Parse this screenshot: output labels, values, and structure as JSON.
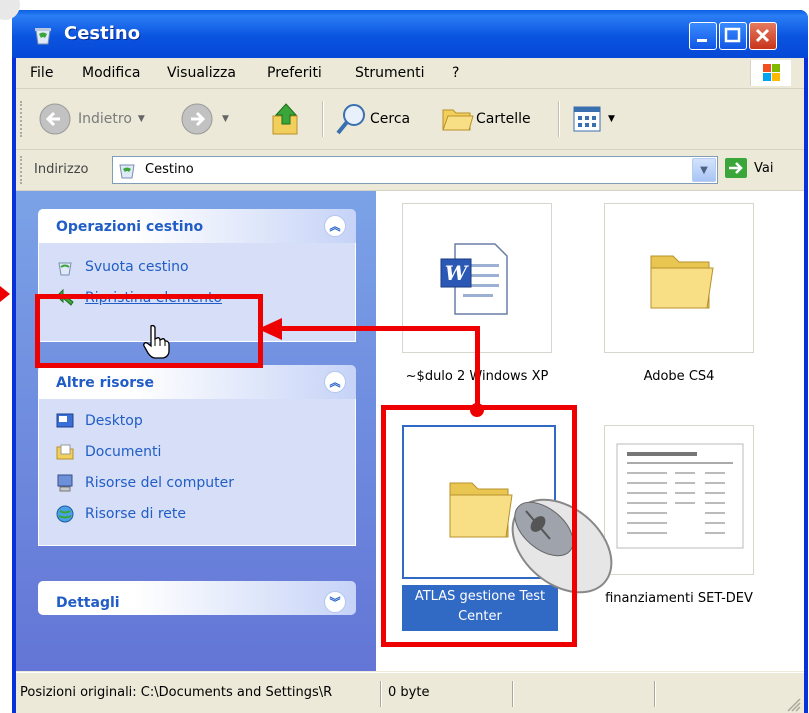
{
  "window": {
    "title": "Cestino"
  },
  "menu": [
    "File",
    "Modifica",
    "Visualizza",
    "Preferiti",
    "Strumenti",
    "?"
  ],
  "toolbar": {
    "back_label": "Indietro",
    "search_label": "Cerca",
    "folders_label": "Cartelle"
  },
  "address": {
    "label": "Indirizzo",
    "value": "Cestino",
    "go_label": "Vai"
  },
  "tasks": {
    "panel1_title": "Operazioni cestino",
    "empty_bin": "Svuota cestino",
    "restore_item": "Ripristina elemento",
    "panel2_title": "Altre risorse",
    "other": [
      "Desktop",
      "Documenti",
      "Risorse del computer",
      "Risorse di rete"
    ],
    "panel3_title": "Dettagli"
  },
  "files": [
    {
      "name": "~$dulo 2 Windows XP",
      "type": "word-document-icon"
    },
    {
      "name": "Adobe CS4",
      "type": "folder-icon"
    },
    {
      "name": "ATLAS gestione Test Center",
      "type": "folder-icon",
      "selected": true
    },
    {
      "name": "finanziamenti SET-DEV",
      "type": "document-thumbnail"
    }
  ],
  "status": {
    "location": "Posizioni originali: C:\\Documents and Settings\\R",
    "size": "0 byte"
  },
  "colors": {
    "annotation": "#e00000",
    "selection": "#316ac5",
    "task_link": "#215dc6"
  }
}
